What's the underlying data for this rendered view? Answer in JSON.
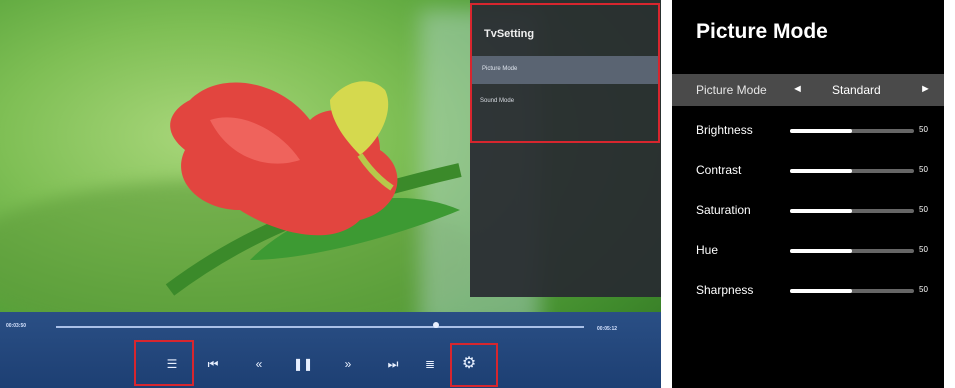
{
  "tv": {
    "menu": {
      "title": "TvSetting",
      "items": [
        "Picture Mode",
        "Sound Mode"
      ]
    },
    "player": {
      "time_elapsed": "00:03:50",
      "time_total": "00:05:12",
      "progress": 0.72,
      "controls": [
        {
          "name": "playlist-icon",
          "glyph": "☰"
        },
        {
          "name": "previous-icon",
          "glyph": "⏮"
        },
        {
          "name": "rewind-icon",
          "glyph": "«"
        },
        {
          "name": "pause-icon",
          "glyph": "❚❚"
        },
        {
          "name": "fast-forward-icon",
          "glyph": "»"
        },
        {
          "name": "next-icon",
          "glyph": "⏭"
        },
        {
          "name": "list-icon",
          "glyph": "≣"
        },
        {
          "name": "settings-icon",
          "glyph": "⚙"
        }
      ]
    }
  },
  "panel": {
    "title": "Picture Mode",
    "mode_row": {
      "label": "Picture Mode",
      "value": "Standard",
      "left_arrow": "◄",
      "right_arrow": "►"
    },
    "settings": [
      {
        "label": "Brightness",
        "value": "50",
        "level": 0.5
      },
      {
        "label": "Contrast",
        "value": "50",
        "level": 0.5
      },
      {
        "label": "Saturation",
        "value": "50",
        "level": 0.5
      },
      {
        "label": "Hue",
        "value": "50",
        "level": 0.5
      },
      {
        "label": "Sharpness",
        "value": "50",
        "level": 0.5
      }
    ],
    "accent": "#4a4a4a"
  },
  "highlight_color": "#d7262e"
}
